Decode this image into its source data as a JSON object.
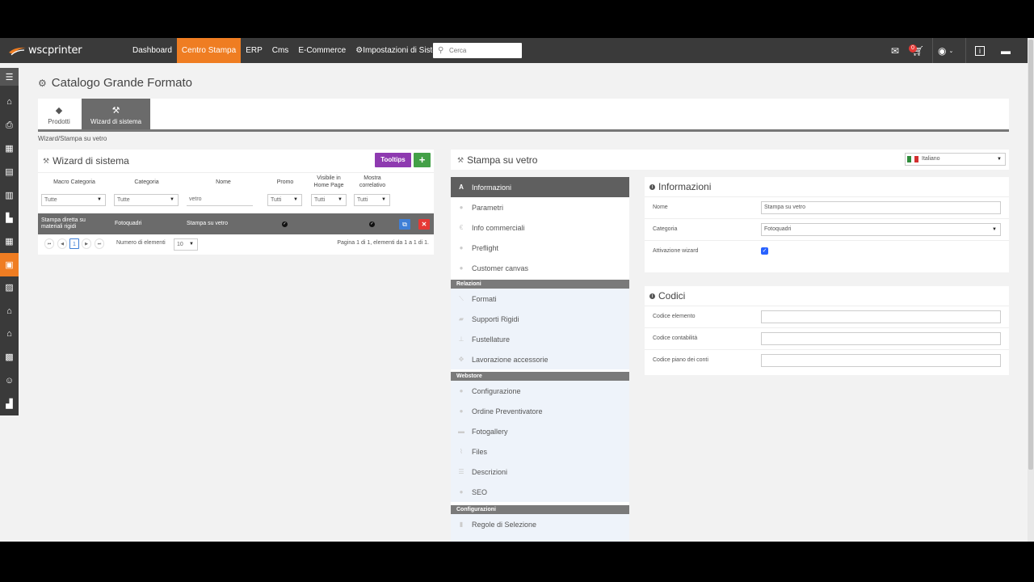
{
  "app": {
    "logo_text": "wscprinter",
    "nav": [
      "Dashboard",
      "Centro Stampa",
      "ERP",
      "Cms",
      "E-Commerce",
      "Impostazioni di Sistema"
    ],
    "search_placeholder": "Cerca",
    "cart_badge": "0",
    "accent": "#ef7d22"
  },
  "page": {
    "title": "Catalogo Grande Formato",
    "tabs": [
      "Prodotti",
      "Wizard di sistema"
    ],
    "breadcrumb": "Wizard/Stampa su vetro"
  },
  "left_panel": {
    "title": "Wizard di sistema",
    "tooltips_label": "Tooltips",
    "add_label": "+",
    "columns": [
      "Macro Categoria",
      "Categoria",
      "Nome",
      "Promo",
      "Visibile in Home Page",
      "Mostra correlativo"
    ],
    "filters": {
      "macro": "Tutte",
      "categoria": "Tutte",
      "nome": "vetro",
      "promo": "Tutti",
      "visibile": "Tutti",
      "mostra": "Tutti"
    },
    "row": {
      "macro": "Stampa diretta su materiali rigidi",
      "categoria": "Fotoquadri",
      "nome": "Stampa su vetro"
    },
    "pager": {
      "current_page": "1",
      "items_label": "Numero di elementi",
      "items_value": "10",
      "summary": "Pagina 1 di 1, elementi da 1 a 1 di 1."
    }
  },
  "right_panel": {
    "title": "Stampa su vetro",
    "language": "Italiano",
    "menu": {
      "items_top": [
        "Informazioni",
        "Parametri",
        "Info commerciali",
        "Preflight",
        "Customer canvas"
      ],
      "section_relazioni": "Relazioni",
      "items_relazioni": [
        "Formati",
        "Supporti Rigidi",
        "Fustellature",
        "Lavorazione accessorie"
      ],
      "section_webstore": "Webstore",
      "items_webstore": [
        "Configurazione",
        "Ordine Preventivatore",
        "Fotogallery",
        "Files",
        "Descrizioni",
        "SEO"
      ],
      "section_configurazioni": "Configurazioni",
      "items_configurazioni": [
        "Regole di Selezione"
      ]
    },
    "info_card": {
      "title": "Informazioni",
      "nome_label": "Nome",
      "nome_value": "Stampa su vetro",
      "categoria_label": "Categoria",
      "categoria_value": "Fotoquadri",
      "attivazione_label": "Attivazione wizard"
    },
    "codici_card": {
      "title": "Codici",
      "codice_elemento_label": "Codice elemento",
      "codice_contabilita_label": "Codice contabilità",
      "codice_piano_label": "Codice piano dei conti"
    }
  }
}
